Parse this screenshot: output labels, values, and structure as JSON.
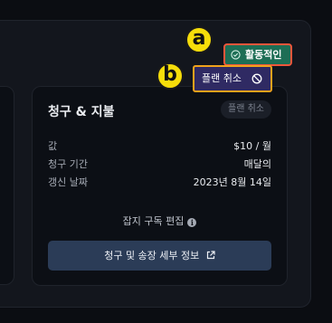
{
  "status_badge": {
    "label": "활동적인",
    "icon": "check-circle-icon",
    "color": "#1d6e55"
  },
  "cancel_plan_button": {
    "label": "플랜 취소",
    "icon": "ban-icon"
  },
  "markers": {
    "a": "a",
    "b": "b"
  },
  "billing": {
    "title": "청구 & 지불",
    "cancel_chip": "플랜 취소",
    "rows": [
      {
        "key": "값",
        "value": "$10 / 월"
      },
      {
        "key": "청구 기간",
        "value": "매달의"
      },
      {
        "key": "갱신 날짜",
        "value": "2023년 8월 14일"
      }
    ],
    "edit_subscription": "잡지 구독 편집",
    "details_button": "청구 및 송장 세부 정보"
  },
  "colors": {
    "highlight_a": "#f0563b",
    "highlight_b": "#f0a21b",
    "button_bg": "#2b3c57"
  }
}
